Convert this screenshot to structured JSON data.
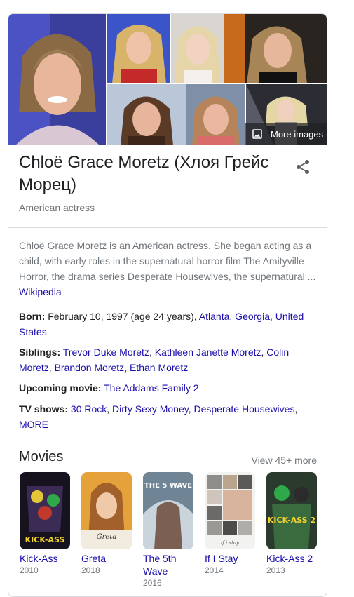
{
  "gallery": {
    "more_images_label": "More images"
  },
  "header": {
    "title": "Chloë Grace Moretz (Хлоя Грейс Морец)",
    "subtitle": "American actress"
  },
  "description": {
    "text": "Chloë Grace Moretz is an American actress. She began acting as a child, with early roles in the supernatural horror film The Amityville Horror, the drama series Desperate Housewives, the supernatural ...",
    "source_link": "Wikipedia"
  },
  "facts": {
    "born": {
      "label": "Born:",
      "value": "February 10, 1997 (age 24 years),",
      "place": "Atlanta, Georgia, United States"
    },
    "siblings": {
      "label": "Siblings:",
      "items": [
        "Trevor Duke Moretz",
        "Kathleen Janette Moretz",
        "Colin Moretz",
        "Brandon Moretz",
        "Ethan Moretz"
      ]
    },
    "upcoming": {
      "label": "Upcoming movie:",
      "value": "The Addams Family 2"
    },
    "tv": {
      "label": "TV shows:",
      "items": [
        "30 Rock",
        "Dirty Sexy Money",
        "Desperate Housewives"
      ],
      "more": "MORE"
    }
  },
  "movies": {
    "heading": "Movies",
    "view_more": "View 45+ more",
    "items": [
      {
        "title": "Kick-Ass",
        "year": "2010",
        "poster_text": "KICK-ASS"
      },
      {
        "title": "Greta",
        "year": "2018",
        "poster_text": "Greta"
      },
      {
        "title": "The 5th Wave",
        "year": "2016",
        "poster_text": "THE 5 WAVE"
      },
      {
        "title": "If I Stay",
        "year": "2014",
        "poster_text": "if i stay"
      },
      {
        "title": "Kick-Ass 2",
        "year": "2013",
        "poster_text": "KICK-ASS 2"
      }
    ]
  },
  "colors": {
    "link": "#1a0dab",
    "secondary_text": "#70757a",
    "divider": "#dadce0"
  },
  "icons": {
    "share": "share-icon",
    "image": "image-icon"
  }
}
